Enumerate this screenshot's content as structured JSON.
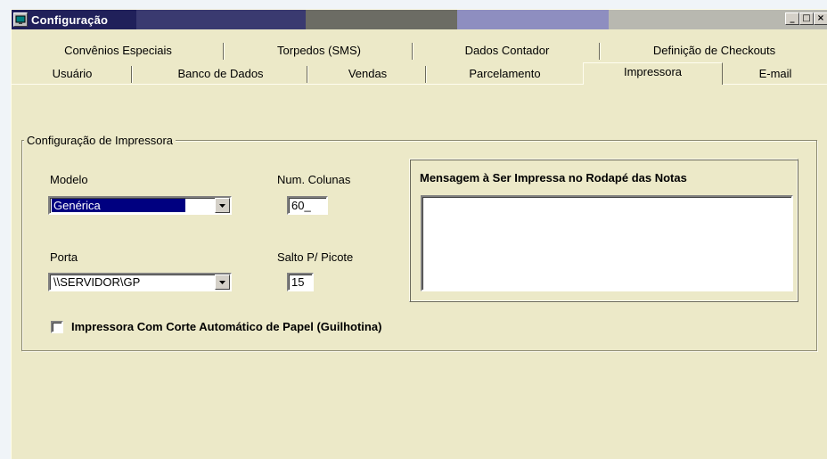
{
  "window": {
    "title": "Configuração",
    "buttons": {
      "minimize": "_",
      "maximize": "□",
      "close": "×"
    }
  },
  "tabs": {
    "row1": [
      {
        "label": "Convênios Especiais",
        "active": false
      },
      {
        "label": "Torpedos (SMS)",
        "active": false
      },
      {
        "label": "Dados Contador",
        "active": false
      },
      {
        "label": "Definição de Checkouts",
        "active": false
      }
    ],
    "row2": [
      {
        "label": "Usuário",
        "active": false
      },
      {
        "label": "Banco de Dados",
        "active": false
      },
      {
        "label": "Vendas",
        "active": false
      },
      {
        "label": "Parcelamento",
        "active": false
      },
      {
        "label": "Impressora",
        "active": true
      },
      {
        "label": "E-mail",
        "active": false
      }
    ]
  },
  "printer_config": {
    "group_title": "Configuração de Impressora",
    "model_label": "Modelo",
    "model_value": "Genérica",
    "columns_label": "Num. Colunas",
    "columns_value": "60_",
    "port_label": "Porta",
    "port_value": "\\\\SERVIDOR\\GP",
    "cut_label": "Salto P/ Picote",
    "cut_value": "15",
    "footer_message_title": "Mensagem à Ser Impressa no Rodapé das Notas",
    "footer_message_value": "",
    "auto_cut_label": "Impressora Com Corte Automático de Papel (Guilhotina)",
    "auto_cut_checked": false
  },
  "colors": {
    "dialog_bg": "#ece9c8",
    "title_text": "#ffffff",
    "selection": "#000080"
  }
}
